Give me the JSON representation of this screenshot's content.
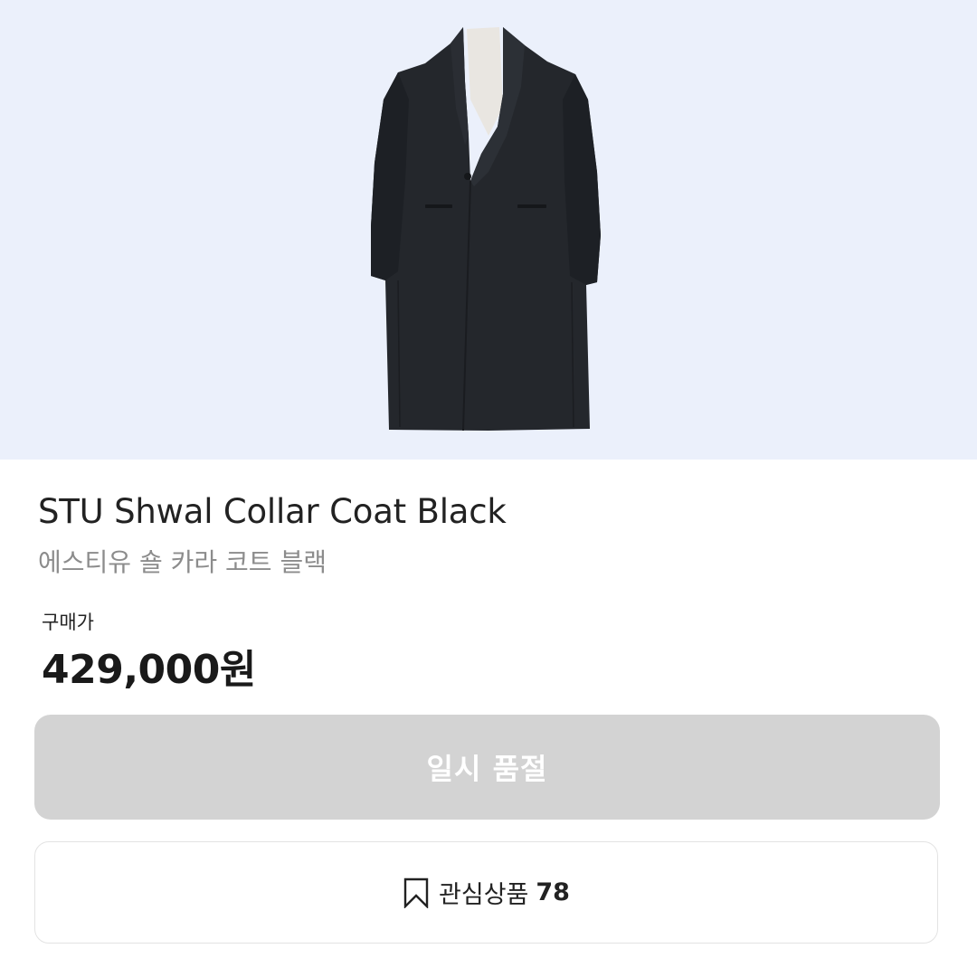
{
  "product": {
    "name_en": "STU Shwal Collar Coat Black",
    "name_ko": "에스티유 숄 카라 코트 블랙"
  },
  "price": {
    "label": "구매가",
    "value": "429,000원"
  },
  "actions": {
    "sold_out_label": "일시 품절",
    "wishlist_label": "관심상품",
    "wishlist_count": "78"
  },
  "colors": {
    "hero_background": "#ebf0fb",
    "disabled_button": "#d3d3d3",
    "coat": "#24272c"
  },
  "icons": {
    "wishlist": "bookmark-icon"
  }
}
